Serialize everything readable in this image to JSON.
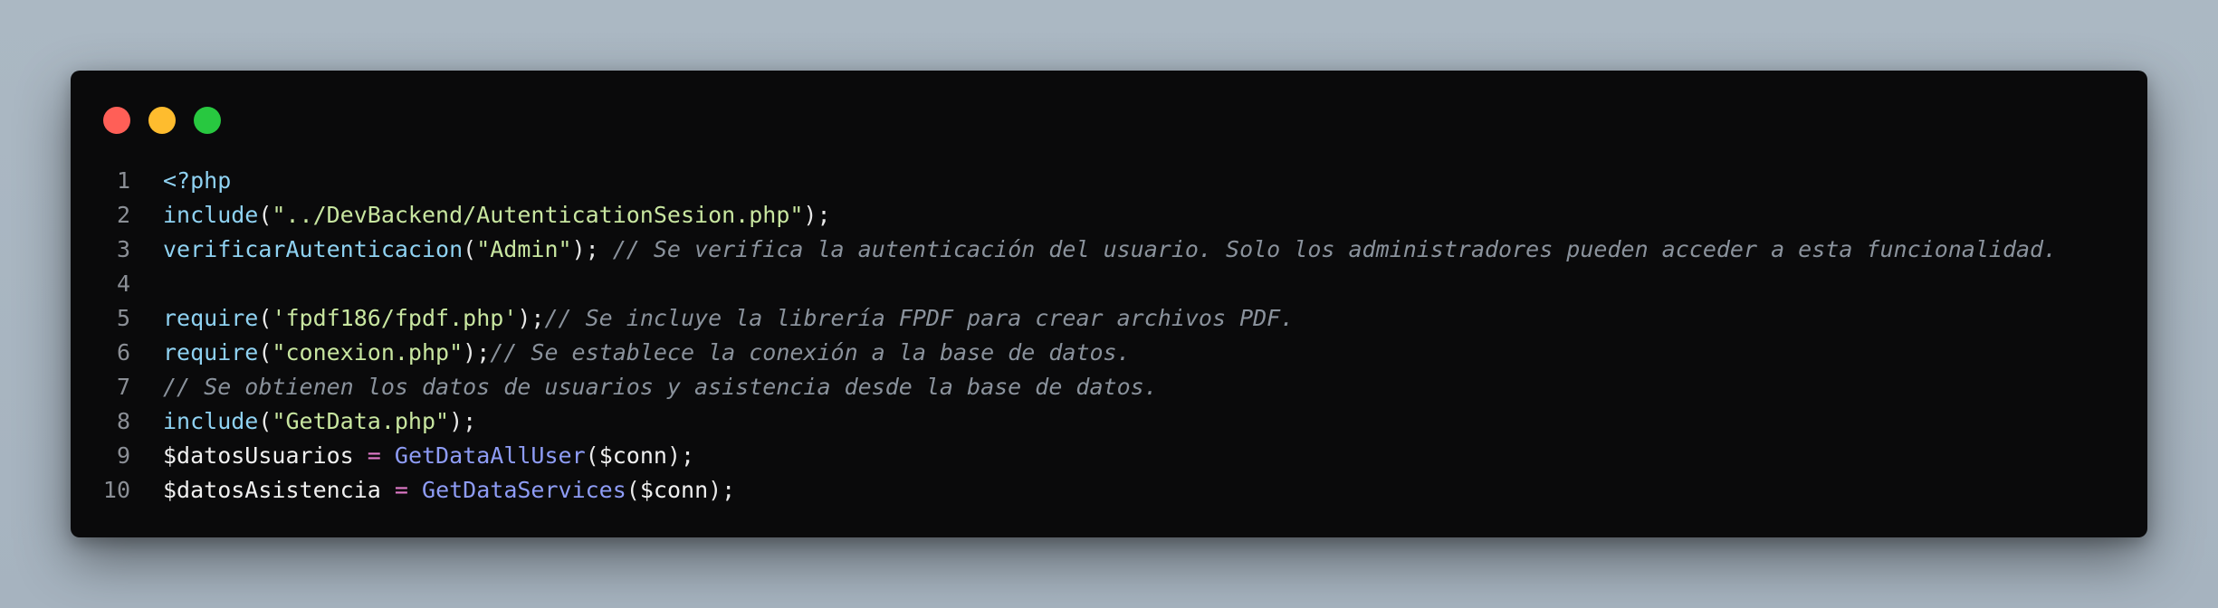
{
  "window": {
    "controls": [
      "close",
      "minimize",
      "maximize"
    ],
    "colors": {
      "close": "#ff5f57",
      "minimize": "#febc2e",
      "maximize": "#28c840",
      "background": "#0a0a0b"
    }
  },
  "code": {
    "language": "php",
    "lines": [
      {
        "n": "1",
        "tokens": [
          {
            "t": "<?php",
            "c": "kw"
          }
        ]
      },
      {
        "n": "2",
        "tokens": [
          {
            "t": "include",
            "c": "kw"
          },
          {
            "t": "(",
            "c": "pn"
          },
          {
            "t": "\"../DevBackend/AutenticationSesion.php\"",
            "c": "str"
          },
          {
            "t": ");",
            "c": "pn"
          }
        ]
      },
      {
        "n": "3",
        "tokens": [
          {
            "t": "verificarAutenticacion",
            "c": "kw"
          },
          {
            "t": "(",
            "c": "pn"
          },
          {
            "t": "\"Admin\"",
            "c": "str"
          },
          {
            "t": "); ",
            "c": "pn"
          },
          {
            "t": "// Se verifica la autenticación del usuario. Solo los administradores pueden acceder a esta funcionalidad.",
            "c": "cm"
          }
        ]
      },
      {
        "n": "4",
        "tokens": []
      },
      {
        "n": "5",
        "tokens": [
          {
            "t": "require",
            "c": "kw"
          },
          {
            "t": "(",
            "c": "pn"
          },
          {
            "t": "'fpdf186/fpdf.php'",
            "c": "str"
          },
          {
            "t": ");",
            "c": "pn"
          },
          {
            "t": "// Se incluye la librería FPDF para crear archivos PDF.",
            "c": "cm"
          }
        ]
      },
      {
        "n": "6",
        "tokens": [
          {
            "t": "require",
            "c": "kw"
          },
          {
            "t": "(",
            "c": "pn"
          },
          {
            "t": "\"conexion.php\"",
            "c": "str"
          },
          {
            "t": ");",
            "c": "pn"
          },
          {
            "t": "// Se establece la conexión a la base de datos.",
            "c": "cm"
          }
        ]
      },
      {
        "n": "7",
        "tokens": [
          {
            "t": "// Se obtienen los datos de usuarios y asistencia desde la base de datos.",
            "c": "cm"
          }
        ]
      },
      {
        "n": "8",
        "tokens": [
          {
            "t": "include",
            "c": "kw"
          },
          {
            "t": "(",
            "c": "pn"
          },
          {
            "t": "\"GetData.php\"",
            "c": "str"
          },
          {
            "t": ");",
            "c": "pn"
          }
        ]
      },
      {
        "n": "9",
        "tokens": [
          {
            "t": "$datosUsuarios",
            "c": "var"
          },
          {
            "t": " ",
            "c": "pn"
          },
          {
            "t": "=",
            "c": "op"
          },
          {
            "t": " ",
            "c": "pn"
          },
          {
            "t": "GetDataAllUser",
            "c": "fn"
          },
          {
            "t": "(",
            "c": "pn"
          },
          {
            "t": "$conn",
            "c": "var"
          },
          {
            "t": ");",
            "c": "pn"
          }
        ]
      },
      {
        "n": "10",
        "tokens": [
          {
            "t": "$datosAsistencia",
            "c": "var"
          },
          {
            "t": " ",
            "c": "pn"
          },
          {
            "t": "=",
            "c": "op"
          },
          {
            "t": " ",
            "c": "pn"
          },
          {
            "t": "GetDataServices",
            "c": "fn"
          },
          {
            "t": "(",
            "c": "pn"
          },
          {
            "t": "$conn",
            "c": "var"
          },
          {
            "t": ");",
            "c": "pn"
          }
        ]
      }
    ]
  }
}
